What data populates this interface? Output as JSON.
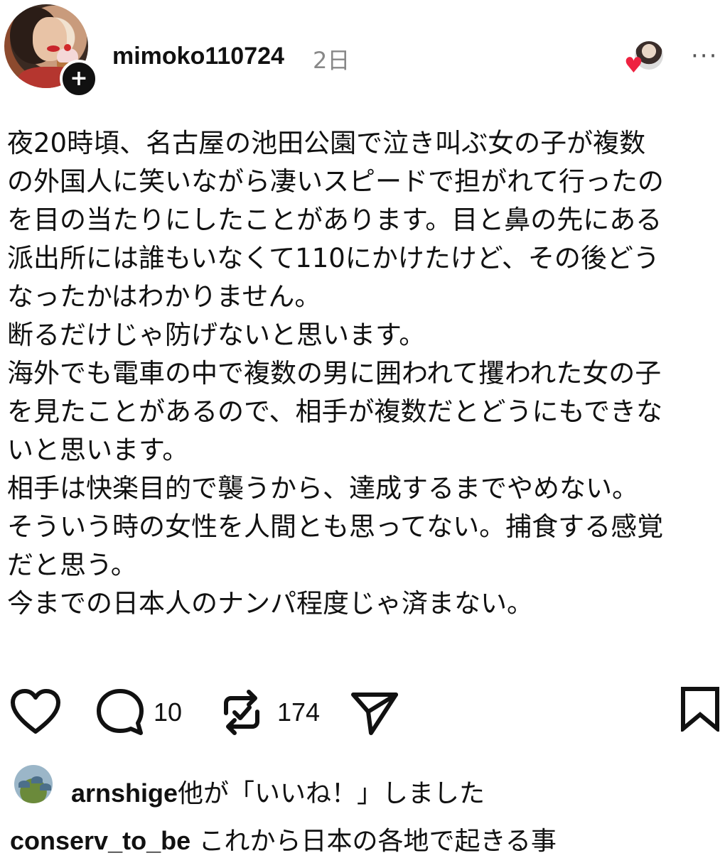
{
  "post": {
    "username": "mimoko110724",
    "time": "2日",
    "body": "夜20時頃、名古屋の池田公園で泣き叫ぶ女の子が複数\nの外国人に笑いながら凄いスピードで担がれて行ったの\nを目の当たりにしたことがあります。目と鼻の先にある\n派出所には誰もいなくて110にかけたけど、その後どう\nなったかはわかりません。\n断るだけじゃ防げないと思います。\n海外でも電車の中で複数の男に囲われて攫われた女の子\nを見たことがあるので、相手が複数だとどうにもできな\nいと思います。\n相手は快楽目的で襲うから、達成するまでやめない。\nそういう時の女性を人間とも思ってない。捕食する感覚\nだと思う。\n今までの日本人のナンパ程度じゃ済まない。"
  },
  "actions": {
    "comment_count": "10",
    "repost_count": "174"
  },
  "likes": {
    "username": "arnshige",
    "text": "他が「いいね！」しました"
  },
  "comment_preview": {
    "username": "conserv_to_be",
    "text": " これから日本の各地で起きる事"
  },
  "colors": {
    "text": "#111111",
    "muted": "#888888",
    "heart": "#ee2240"
  },
  "icons": [
    "follow-plus-icon",
    "heart-icon",
    "more-icon",
    "like-icon",
    "comment-icon",
    "repost-icon",
    "share-icon",
    "bookmark-icon"
  ]
}
